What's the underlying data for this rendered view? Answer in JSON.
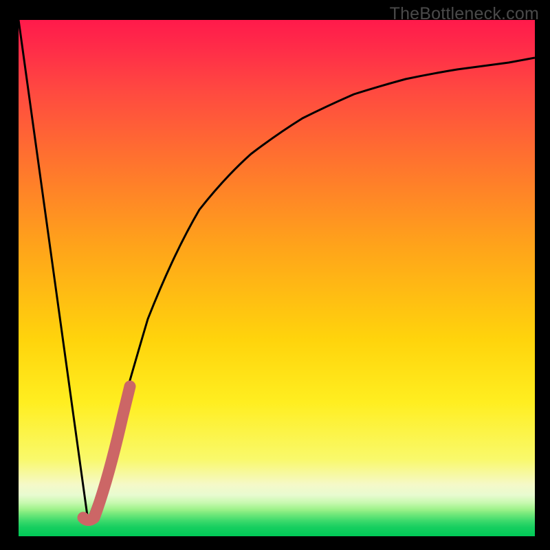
{
  "watermark": {
    "text": "TheBottleneck.com"
  },
  "colors": {
    "frame": "#000000",
    "curve": "#000000",
    "highlight": "#cc6666",
    "gradient_top": "#ff1a4b",
    "gradient_bottom": "#00c957"
  },
  "chart_data": {
    "type": "line",
    "title": "",
    "xlabel": "",
    "ylabel": "",
    "xlim": [
      0,
      100
    ],
    "ylim": [
      0,
      100
    ],
    "series": [
      {
        "name": "left-line",
        "x": [
          0,
          13.5
        ],
        "y": [
          100,
          3
        ]
      },
      {
        "name": "right-curve",
        "x": [
          13.5,
          16,
          20,
          25,
          30,
          35,
          40,
          45,
          50,
          55,
          60,
          65,
          70,
          75,
          80,
          85,
          90,
          95,
          100
        ],
        "y": [
          3,
          10,
          25,
          42,
          54,
          63,
          69.5,
          74.5,
          78.5,
          81.5,
          84,
          86,
          87.6,
          88.9,
          90,
          90.9,
          91.6,
          92.2,
          92.7
        ]
      },
      {
        "name": "highlight-segment",
        "x": [
          13,
          14,
          16,
          18,
          20,
          21.5
        ],
        "y": [
          3.5,
          3.2,
          8,
          15,
          23,
          29
        ]
      }
    ]
  }
}
